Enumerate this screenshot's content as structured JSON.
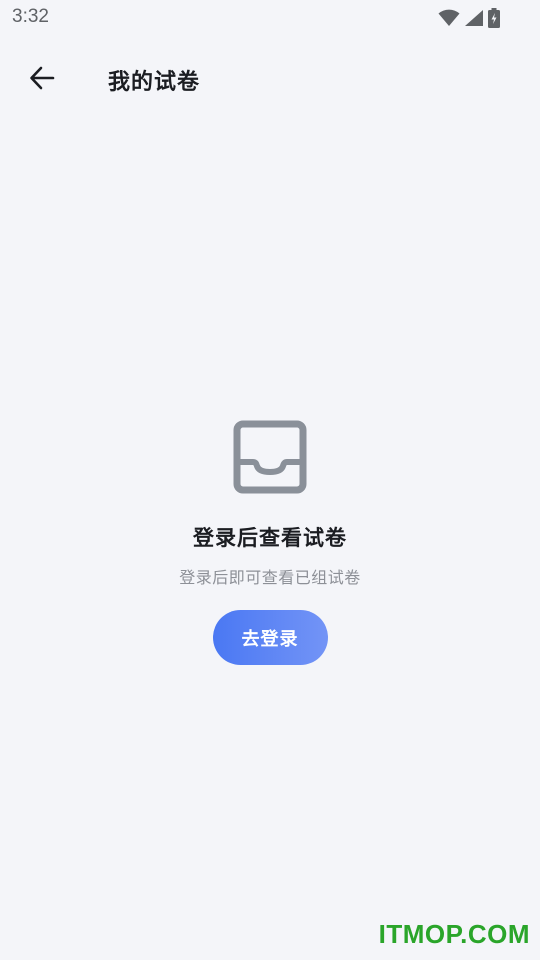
{
  "status_bar": {
    "time": "3:32",
    "icons": [
      "wifi-icon",
      "signal-icon",
      "battery-charging-icon"
    ]
  },
  "app_bar": {
    "back_icon": "arrow-left-icon",
    "title": "我的试卷"
  },
  "empty_state": {
    "icon": "inbox-tray-icon",
    "title": "登录后查看试卷",
    "subtitle": "登录后即可查看已组试卷",
    "button_label": "去登录"
  },
  "colors": {
    "background": "#f4f5f9",
    "accent_start": "#4a78f3",
    "accent_end": "#7394f6",
    "icon_gray": "#8a9099",
    "watermark": "#2aa52a"
  },
  "watermark": "ITMOP.COM"
}
